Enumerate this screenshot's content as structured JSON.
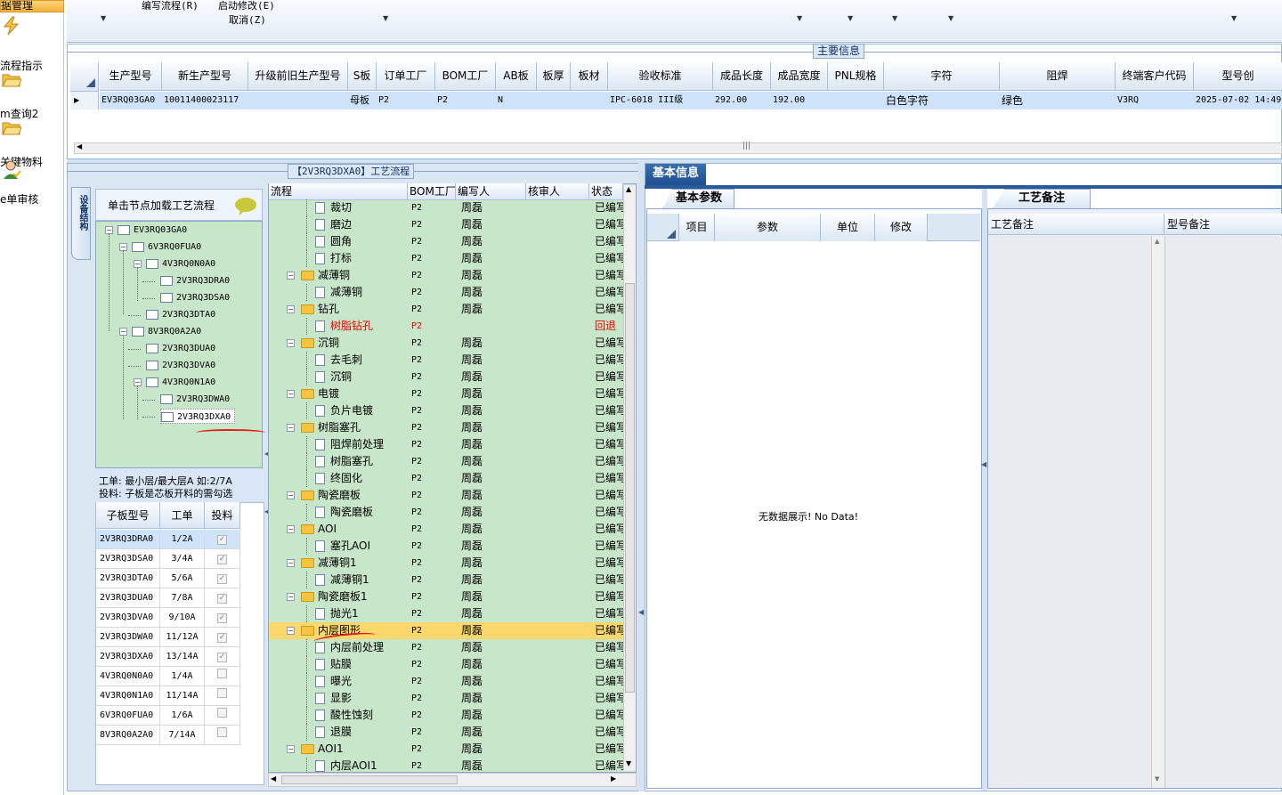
{
  "nav": {
    "title": "据管理",
    "items": [
      {
        "label": "流程指示",
        "icon": "lightning-icon"
      },
      {
        "label": "m查询2",
        "icon": "folder-open-icon"
      },
      {
        "label": "关键物料",
        "icon": "folder-open-icon"
      },
      {
        "label": "e单审核",
        "icon": "user-approve-icon"
      }
    ]
  },
  "toolbar": {
    "item1": "编写流程(R)",
    "item2": "启动修改(E)",
    "item3": "取消(Z)"
  },
  "main_info": {
    "caption": "主要信息",
    "columns": [
      "生产型号",
      "新生产型号",
      "升级前旧生产型号",
      "S板",
      "订单工厂",
      "BOM工厂",
      "AB板",
      "板厚",
      "板材",
      "验收标准",
      "成品长度",
      "成品宽度",
      "PNL规格",
      "字符",
      "阻焊",
      "终端客户代码",
      "型号创"
    ],
    "row": [
      "EV3RQ03GA0",
      "10011400023117",
      "",
      "母板",
      "P2",
      "P2",
      "N",
      "",
      "",
      "IPC-6018 III级",
      "292.00",
      "192.00",
      "",
      "白色字符",
      "绿色",
      "V3RQ",
      "2025-07-02 14:49"
    ]
  },
  "process_panel": {
    "caption": "【2V3RQ3DXA0】工艺流程",
    "side_tab": "设备结构",
    "tree_hint": "单击节点加载工艺流程",
    "tree": [
      {
        "label": "EV3RQ03GA0",
        "level": 0,
        "expand": "−"
      },
      {
        "label": "6V3RQ0FUA0",
        "level": 1,
        "expand": "−"
      },
      {
        "label": "4V3RQ0N0A0",
        "level": 2,
        "expand": "−"
      },
      {
        "label": "2V3RQ3DRA0",
        "level": 3,
        "expand": ""
      },
      {
        "label": "2V3RQ3DSA0",
        "level": 3,
        "expand": ""
      },
      {
        "label": "2V3RQ3DTA0",
        "level": 2,
        "expand": ""
      },
      {
        "label": "8V3RQ0A2A0",
        "level": 1,
        "expand": "−"
      },
      {
        "label": "2V3RQ3DUA0",
        "level": 2,
        "expand": ""
      },
      {
        "label": "2V3RQ3DVA0",
        "level": 2,
        "expand": ""
      },
      {
        "label": "4V3RQ0N1A0",
        "level": 2,
        "expand": "−"
      },
      {
        "label": "2V3RQ3DWA0",
        "level": 3,
        "expand": ""
      },
      {
        "label": "2V3RQ3DXA0",
        "level": 3,
        "expand": ""
      }
    ],
    "note1": "工单: 最小层/最大层A 如:2/7A",
    "note2": "投料: 子板是芯板开料的需勾选",
    "sub_headers": [
      "子板型号",
      "工单",
      "投料"
    ],
    "sub_rows": [
      {
        "model": "2V3RQ3DRA0",
        "order": "1/2A",
        "checked": true
      },
      {
        "model": "2V3RQ3DSA0",
        "order": "3/4A",
        "checked": true
      },
      {
        "model": "2V3RQ3DTA0",
        "order": "5/6A",
        "checked": true
      },
      {
        "model": "2V3RQ3DUA0",
        "order": "7/8A",
        "checked": true
      },
      {
        "model": "2V3RQ3DVA0",
        "order": "9/10A",
        "checked": true
      },
      {
        "model": "2V3RQ3DWA0",
        "order": "11/12A",
        "checked": true
      },
      {
        "model": "2V3RQ3DXA0",
        "order": "13/14A",
        "checked": true
      },
      {
        "model": "4V3RQ0N0A0",
        "order": "1/4A",
        "checked": false
      },
      {
        "model": "4V3RQ0N1A0",
        "order": "11/14A",
        "checked": false
      },
      {
        "model": "6V3RQ0FUA0",
        "order": "1/6A",
        "checked": false
      },
      {
        "model": "8V3RQ0A2A0",
        "order": "7/14A",
        "checked": false
      }
    ],
    "flow_headers": [
      "流程",
      "BOM工厂",
      "编写人",
      "核审人",
      "状态"
    ],
    "flow_rows": [
      {
        "name": "裁切",
        "type": "doc",
        "bom": "P2",
        "writer": "周磊",
        "status": "已编写"
      },
      {
        "name": "磨边",
        "type": "doc",
        "bom": "P2",
        "writer": "周磊",
        "status": "已编写"
      },
      {
        "name": "圆角",
        "type": "doc",
        "bom": "P2",
        "writer": "周磊",
        "status": "已编写"
      },
      {
        "name": "打标",
        "type": "doc",
        "bom": "P2",
        "writer": "周磊",
        "status": "已编写"
      },
      {
        "name": "减薄铜",
        "type": "folder",
        "bom": "P2",
        "writer": "周磊",
        "status": "已编写"
      },
      {
        "name": "减薄铜",
        "type": "doc",
        "bom": "P2",
        "writer": "周磊",
        "status": "已编写"
      },
      {
        "name": "钻孔",
        "type": "folder",
        "bom": "P2",
        "writer": "周磊",
        "status": "已编写"
      },
      {
        "name": "树脂钻孔",
        "type": "doc",
        "bom": "P2",
        "writer": "",
        "status": "回退",
        "red": true
      },
      {
        "name": "沉铜",
        "type": "folder",
        "bom": "P2",
        "writer": "周磊",
        "status": "已编写"
      },
      {
        "name": "去毛刺",
        "type": "doc",
        "bom": "P2",
        "writer": "周磊",
        "status": "已编写"
      },
      {
        "name": "沉铜",
        "type": "doc",
        "bom": "P2",
        "writer": "周磊",
        "status": "已编写"
      },
      {
        "name": "电镀",
        "type": "folder",
        "bom": "P2",
        "writer": "周磊",
        "status": "已编写"
      },
      {
        "name": "负片电镀",
        "type": "doc",
        "bom": "P2",
        "writer": "周磊",
        "status": "已编写"
      },
      {
        "name": "树脂塞孔",
        "type": "folder",
        "bom": "P2",
        "writer": "周磊",
        "status": "已编写"
      },
      {
        "name": "阻焊前处理",
        "type": "doc",
        "bom": "P2",
        "writer": "周磊",
        "status": "已编写"
      },
      {
        "name": "树脂塞孔",
        "type": "doc",
        "bom": "P2",
        "writer": "周磊",
        "status": "已编写"
      },
      {
        "name": "终固化",
        "type": "doc",
        "bom": "P2",
        "writer": "周磊",
        "status": "已编写"
      },
      {
        "name": "陶瓷磨板",
        "type": "folder",
        "bom": "P2",
        "writer": "周磊",
        "status": "已编写"
      },
      {
        "name": "陶瓷磨板",
        "type": "doc",
        "bom": "P2",
        "writer": "周磊",
        "status": "已编写"
      },
      {
        "name": "AOI",
        "type": "folder",
        "bom": "P2",
        "writer": "周磊",
        "status": "已编写"
      },
      {
        "name": "塞孔AOI",
        "type": "doc",
        "bom": "P2",
        "writer": "周磊",
        "status": "已编写"
      },
      {
        "name": "减薄铜1",
        "type": "folder",
        "bom": "P2",
        "writer": "周磊",
        "status": "已编写"
      },
      {
        "name": "减薄铜1",
        "type": "doc",
        "bom": "P2",
        "writer": "周磊",
        "status": "已编写"
      },
      {
        "name": "陶瓷磨板1",
        "type": "folder",
        "bom": "P2",
        "writer": "周磊",
        "status": "已编写"
      },
      {
        "name": "抛光1",
        "type": "doc",
        "bom": "P2",
        "writer": "周磊",
        "status": "已编写"
      },
      {
        "name": "内层图形",
        "type": "folder",
        "bom": "P2",
        "writer": "周磊",
        "status": "已编写",
        "selected": true
      },
      {
        "name": "内层前处理",
        "type": "doc",
        "bom": "P2",
        "writer": "周磊",
        "status": "已编写"
      },
      {
        "name": "贴膜",
        "type": "doc",
        "bom": "P2",
        "writer": "周磊",
        "status": "已编写"
      },
      {
        "name": "曝光",
        "type": "doc",
        "bom": "P2",
        "writer": "周磊",
        "status": "已编写"
      },
      {
        "name": "显影",
        "type": "doc",
        "bom": "P2",
        "writer": "周磊",
        "status": "已编写"
      },
      {
        "name": "酸性蚀刻",
        "type": "doc",
        "bom": "P2",
        "writer": "周磊",
        "status": "已编写"
      },
      {
        "name": "退膜",
        "type": "doc",
        "bom": "P2",
        "writer": "周磊",
        "status": "已编写"
      },
      {
        "name": "AOI1",
        "type": "folder",
        "bom": "P2",
        "writer": "周磊",
        "status": "已编写"
      },
      {
        "name": "内层AOI1",
        "type": "doc",
        "bom": "P2",
        "writer": "周磊",
        "status": "已编写"
      }
    ]
  },
  "basic_info": {
    "tab": "基本信息",
    "sub_tab": "基本参数",
    "headers": [
      "项目",
      "参数",
      "单位",
      "修改"
    ],
    "empty_text": "无数据展示! No Data!"
  },
  "remarks": {
    "tab": "工艺备注",
    "col1": "工艺备注",
    "col2": "型号备注"
  },
  "colors": {
    "tree_bg": "#c8e6c9",
    "selected_row": "#fbd86b",
    "accent": "#1f4f8f",
    "warning": "#e00000"
  }
}
